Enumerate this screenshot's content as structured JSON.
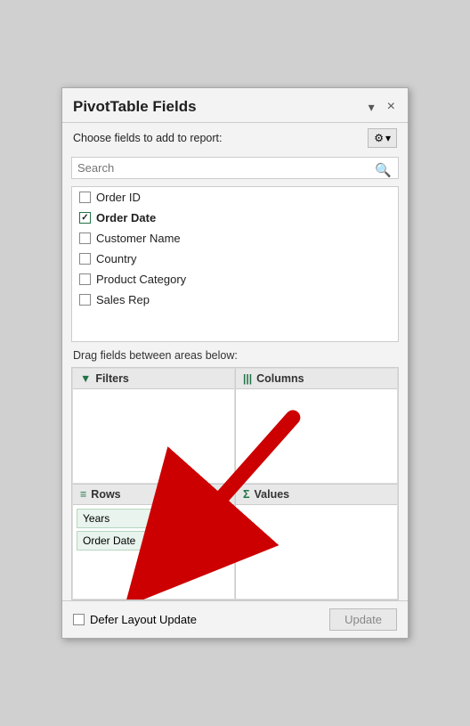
{
  "panel": {
    "title": "PivotTable Fields",
    "dropdown_icon": "▾",
    "close_icon": "×"
  },
  "subheader": {
    "label": "Choose fields to add to report:",
    "gear_icon": "⚙",
    "gear_dropdown": "▾"
  },
  "search": {
    "placeholder": "Search",
    "icon": "🔍"
  },
  "fields": [
    {
      "label": "Order ID",
      "checked": false
    },
    {
      "label": "Order Date",
      "checked": true
    },
    {
      "label": "Customer Name",
      "checked": false
    },
    {
      "label": "Country",
      "checked": false
    },
    {
      "label": "Product Category",
      "checked": false
    },
    {
      "label": "Sales Rep",
      "checked": false
    }
  ],
  "areas_label": "Drag fields between areas below:",
  "areas": {
    "filters": {
      "label": "Filters",
      "icon": "▼",
      "items": []
    },
    "columns": {
      "label": "Columns",
      "icon": "|||",
      "items": []
    },
    "rows": {
      "label": "Rows",
      "icon": "≡",
      "items": [
        {
          "label": "Years"
        },
        {
          "label": "Order Date"
        }
      ]
    },
    "values": {
      "label": "Values",
      "icon": "Σ",
      "items": []
    }
  },
  "footer": {
    "defer_label": "Defer Layout Update",
    "update_label": "Update"
  }
}
